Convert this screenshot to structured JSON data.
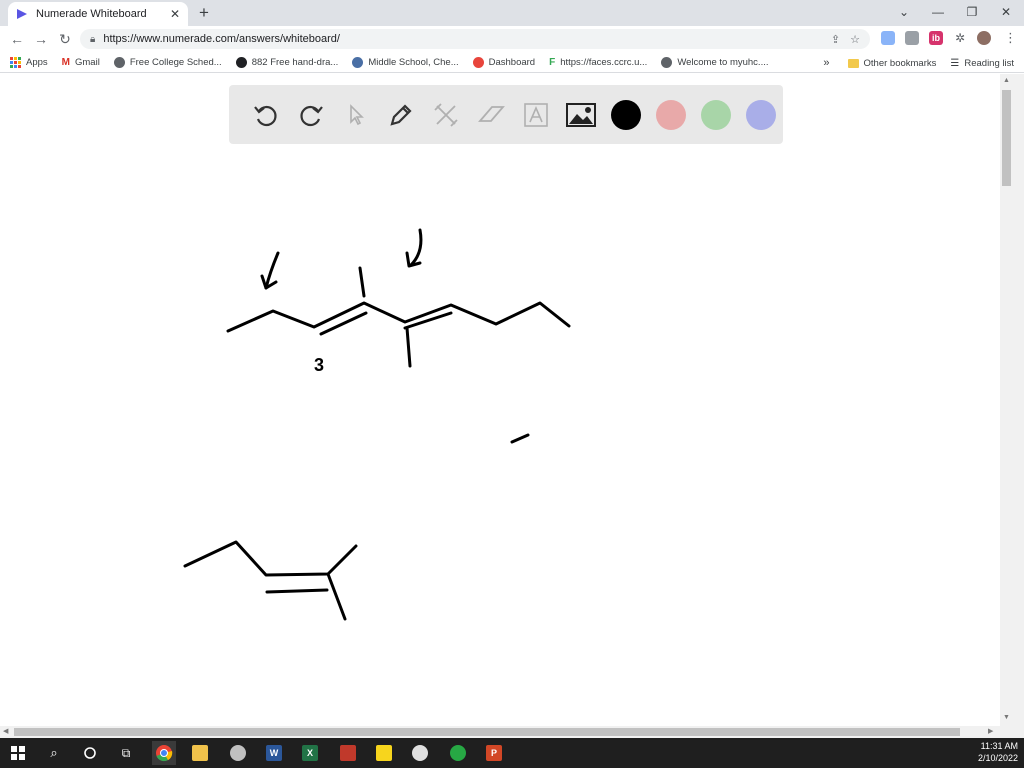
{
  "browser": {
    "tab_title": "Numerade Whiteboard",
    "tab_close": "✕",
    "new_tab": "+",
    "url": "https://www.numerade.com/answers/whiteboard/",
    "window_controls": [
      "⌄",
      "—",
      "❐",
      "✕"
    ]
  },
  "bookmarks": {
    "items": [
      {
        "label": "Apps",
        "icon": "apps-grid-icon",
        "color": "#ea4335"
      },
      {
        "label": "Gmail",
        "icon": "gmail-icon",
        "color": "#d93025"
      },
      {
        "label": "Free College Sched...",
        "icon": "globe-icon",
        "color": "#5f6368"
      },
      {
        "label": "882 Free hand-dra...",
        "icon": "site-icon",
        "color": "#202124"
      },
      {
        "label": "Middle School, Che...",
        "icon": "site-icon",
        "color": "#4a6fa5"
      },
      {
        "label": "Dashboard",
        "icon": "site-icon",
        "color": "#e8453c"
      },
      {
        "label": "https://faces.ccrc.u...",
        "icon": "site-icon",
        "color": "#34a853"
      },
      {
        "label": "Welcome to myuhc....",
        "icon": "globe-icon",
        "color": "#5f6368"
      }
    ],
    "overflow": "»",
    "other_bookmarks": "Other bookmarks",
    "reading_list": "Reading list"
  },
  "whiteboard_toolbar": {
    "tools": [
      "undo-icon",
      "redo-icon",
      "pointer-icon",
      "pen-icon",
      "tools-icon",
      "eraser-icon",
      "text-icon",
      "image-icon"
    ],
    "colors": [
      "#000000",
      "#e8a9a9",
      "#a8d5a8",
      "#a9aee8"
    ]
  },
  "canvas": {
    "annotation": "3"
  },
  "taskbar": {
    "apps": [
      {
        "icon": "chrome-icon",
        "color": "#fbbc04"
      },
      {
        "icon": "file-explorer-icon",
        "color": "#f0c24b"
      },
      {
        "icon": "snip-icon",
        "color": "#c0c0c0"
      },
      {
        "icon": "word-icon",
        "color": "#2b579a",
        "letter": "W"
      },
      {
        "icon": "excel-icon",
        "color": "#217346",
        "letter": "X"
      },
      {
        "icon": "app-icon",
        "color": "#c0392b",
        "letter": ""
      },
      {
        "icon": "sticky-notes-icon",
        "color": "#f7d51d",
        "letter": ""
      },
      {
        "icon": "clock-app-icon",
        "color": "#e0e0e0",
        "letter": ""
      },
      {
        "icon": "app-icon",
        "color": "#27a844",
        "letter": ""
      },
      {
        "icon": "powerpoint-icon",
        "color": "#d24726",
        "letter": "P"
      }
    ],
    "time": "11:31 AM",
    "date": "2/10/2022"
  }
}
